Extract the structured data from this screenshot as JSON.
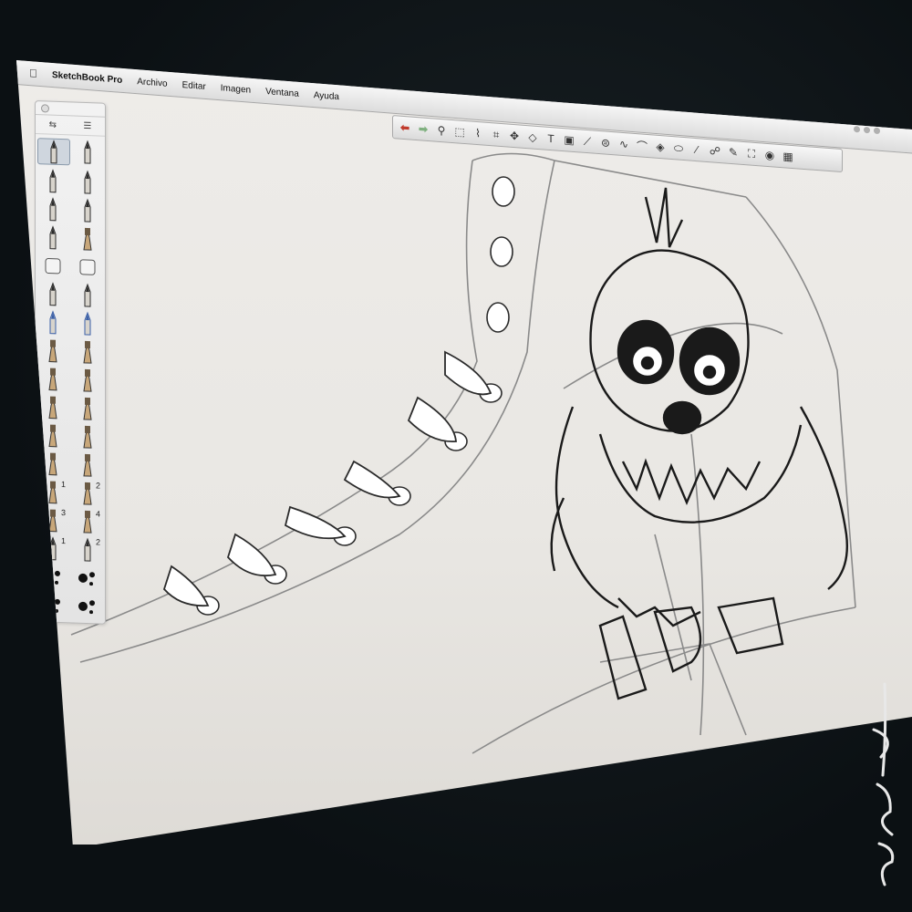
{
  "app": {
    "name": "SketchBook Pro",
    "apple_menu_icon": "apple-icon",
    "menus": [
      "Archivo",
      "Editar",
      "Imagen",
      "Ventana",
      "Ayuda"
    ]
  },
  "brush_palette": {
    "header_icons": [
      "palette-close-icon",
      "brush-settings-icon",
      "brush-library-icon"
    ],
    "brushes": [
      {
        "icon": "pencil-icon",
        "label": ""
      },
      {
        "icon": "ballpoint-pen-icon",
        "label": ""
      },
      {
        "icon": "marker-icon",
        "label": ""
      },
      {
        "icon": "felt-pen-icon",
        "label": ""
      },
      {
        "icon": "fine-pen-icon",
        "label": ""
      },
      {
        "icon": "technical-pen-icon",
        "label": ""
      },
      {
        "icon": "ink-pen-icon",
        "label": ""
      },
      {
        "icon": "brush-pen-icon",
        "label": ""
      },
      {
        "icon": "hard-eraser-icon",
        "label": ""
      },
      {
        "icon": "soft-eraser-icon",
        "label": ""
      },
      {
        "icon": "chisel-marker-icon",
        "label": ""
      },
      {
        "icon": "round-marker-icon",
        "label": ""
      },
      {
        "icon": "blue-marker-icon",
        "label": ""
      },
      {
        "icon": "blue-felt-tip-icon",
        "label": ""
      },
      {
        "icon": "airbrush-icon",
        "label": ""
      },
      {
        "icon": "blue-airbrush-icon",
        "label": ""
      },
      {
        "icon": "round-brush-icon",
        "label": ""
      },
      {
        "icon": "flat-brush-icon",
        "label": ""
      },
      {
        "icon": "fan-brush-icon",
        "label": ""
      },
      {
        "icon": "angled-brush-icon",
        "label": ""
      },
      {
        "icon": "bristle-brush-icon",
        "label": ""
      },
      {
        "icon": "wide-brush-icon",
        "label": ""
      },
      {
        "icon": "dry-brush-icon",
        "label": ""
      },
      {
        "icon": "smudge-brush-icon",
        "label": ""
      },
      {
        "icon": "custom-brush-icon",
        "label": "1"
      },
      {
        "icon": "custom-brush-icon",
        "label": "2"
      },
      {
        "icon": "custom-brush-icon",
        "label": "3"
      },
      {
        "icon": "custom-brush-icon",
        "label": "4"
      },
      {
        "icon": "custom-pen-icon",
        "label": "1"
      },
      {
        "icon": "custom-pen-icon",
        "label": "2"
      },
      {
        "icon": "splatter-brush-icon",
        "label": ""
      },
      {
        "icon": "speckle-brush-icon",
        "label": ""
      },
      {
        "icon": "ink-splat-icon",
        "label": ""
      },
      {
        "icon": "ink-drops-icon",
        "label": ""
      }
    ]
  },
  "toolbar": {
    "tools": [
      {
        "icon": "undo-icon",
        "glyph": "⬅"
      },
      {
        "icon": "redo-icon",
        "glyph": "➡"
      },
      {
        "icon": "zoom-icon",
        "glyph": "⚲"
      },
      {
        "icon": "select-icon",
        "glyph": "⬚"
      },
      {
        "icon": "lasso-icon",
        "glyph": "⌇"
      },
      {
        "icon": "crop-icon",
        "glyph": "⌗"
      },
      {
        "icon": "move-icon",
        "glyph": "✥"
      },
      {
        "icon": "transform-icon",
        "glyph": "◇"
      },
      {
        "icon": "text-icon",
        "glyph": "T"
      },
      {
        "icon": "layer-icon",
        "glyph": "▣"
      },
      {
        "icon": "ruler-icon",
        "glyph": "⟋"
      },
      {
        "icon": "symmetry-icon",
        "glyph": "⊜"
      },
      {
        "icon": "stroke-icon",
        "glyph": "∿"
      },
      {
        "icon": "curve-icon",
        "glyph": "⌒"
      },
      {
        "icon": "fill-icon",
        "glyph": "◈"
      },
      {
        "icon": "shape-icon",
        "glyph": "⬭"
      },
      {
        "icon": "brush-icon",
        "glyph": "⁄"
      },
      {
        "icon": "smudge-icon",
        "glyph": "☍"
      },
      {
        "icon": "copic-icon",
        "glyph": "✎"
      },
      {
        "icon": "lagoon-icon",
        "glyph": "⛶"
      },
      {
        "icon": "color-wheel-icon",
        "glyph": "◉"
      },
      {
        "icon": "swatches-icon",
        "glyph": "▦"
      }
    ]
  },
  "colors": {
    "canvas": "#eceae6",
    "menubar": "#e8e8e8",
    "sketch_ink": "#1a1a1a",
    "construction_lines": "#8a8a8a",
    "bezel": "#0e1417"
  }
}
